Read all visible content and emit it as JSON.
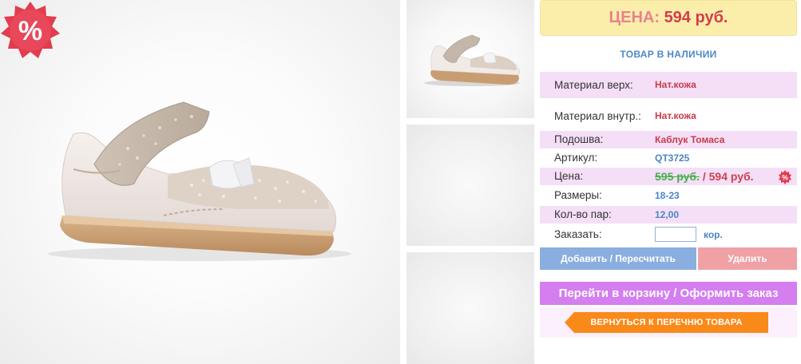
{
  "price_box": {
    "label": "ЦЕНА:",
    "value": "594 руб."
  },
  "stock_status": "ТОВАР В НАЛИЧИИ",
  "badges": {
    "discount": "%"
  },
  "specs": {
    "upper_material": {
      "label": "Материал верх:",
      "value": "Нат.кожа"
    },
    "inner_material": {
      "label": "Материал внутр.:",
      "value": "Нат.кожа"
    },
    "sole": {
      "label": "Подошва:",
      "value": "Каблук Томаса"
    },
    "article": {
      "label": "Артикул:",
      "value": "QT3725"
    },
    "price": {
      "label": "Цена:",
      "old": "595 руб.",
      "separator": " / ",
      "new": "594 руб."
    },
    "sizes": {
      "label": "Размеры:",
      "value": "18-23"
    },
    "pairs": {
      "label": "Кол-во пар:",
      "value": "12,00"
    },
    "order": {
      "label": "Заказать:",
      "value": "",
      "unit": "кор."
    }
  },
  "buttons": {
    "add": "Добавить / Пересчитать",
    "delete": "Удалить",
    "cart": "Перейти в корзину / Оформить заказ",
    "back": "ВЕРНУТЬСЯ К ПЕРЕЧНЮ ТОВАРА"
  },
  "colors": {
    "price_label": "#e8818f",
    "price_value": "#cf3f4d",
    "highlight_row": "#f4dff7",
    "add_button": "#8aaedf",
    "delete_button": "#f0a1a5",
    "cart_button": "#d47ef0",
    "back_button": "#f98a1a",
    "discount_badge": "#e23c4e"
  },
  "icons": {
    "discount": "percent-badge-icon",
    "back": "arrow-left-icon"
  }
}
